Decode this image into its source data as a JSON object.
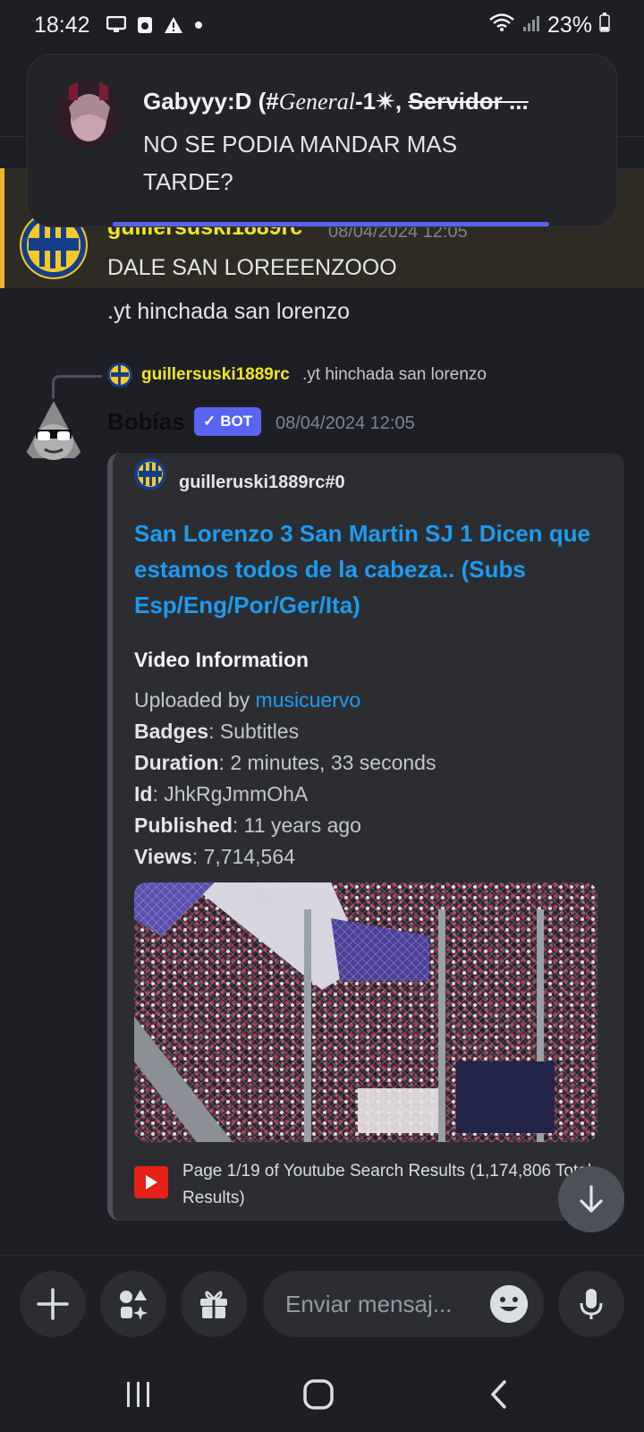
{
  "status_bar": {
    "time": "18:42",
    "battery": "23%",
    "icons": [
      "monitor-icon",
      "app-icon",
      "warning-icon",
      "dot-icon",
      "wifi-icon",
      "signal-icon",
      "battery-icon"
    ]
  },
  "notification": {
    "title_prefix": "Gabyyy:D (#",
    "title_channel": "General",
    "title_suffix": "-1✴, ",
    "title_server": "Servidor ...",
    "body": "NO SE PODIA MANDAR MAS TARDE?"
  },
  "messages": [
    {
      "author": "guillersuski1889rc",
      "timestamp": "08/04/2024 12:05",
      "text": "DALE SAN LOREEENZOOO",
      "highlighted": true
    },
    {
      "text": ".yt hinchada san lorenzo"
    }
  ],
  "reply": {
    "author": "guillersuski1889rc",
    "text": ".yt hinchada san lorenzo"
  },
  "bot_message": {
    "author": "Bobías",
    "badge": "BOT",
    "timestamp": "08/04/2024 12:05",
    "embed": {
      "author": "guilleruski1889rc#0",
      "title": "San Lorenzo 3 San Martin SJ 1 Dicen que estamos todos de la cabeza.. (Subs Esp/Eng/Por/Ger/Ita)",
      "field_title": "Video Information",
      "uploaded_by_label": "Uploaded by ",
      "uploaded_by": "musicuervo",
      "badges_label": "Badges",
      "badges": ": Subtitles",
      "duration_label": "Duration",
      "duration": ": 2 minutes, 33 seconds",
      "id_label": "Id",
      "id": ": JhkRgJmmOhA",
      "published_label": "Published",
      "published": ": 11 years ago",
      "views_label": "Views",
      "views": ": 7,714,564",
      "footer": "Page 1/19 of Youtube Search Results (1,174,806 Total Results)"
    }
  },
  "input": {
    "placeholder": "Enviar mensaj..."
  },
  "colors": {
    "background": "#1e1f24",
    "accent": "#5865f2",
    "link": "#1d9bf0",
    "username": "#f0e62a",
    "highlight_bar": "#f0b232"
  }
}
